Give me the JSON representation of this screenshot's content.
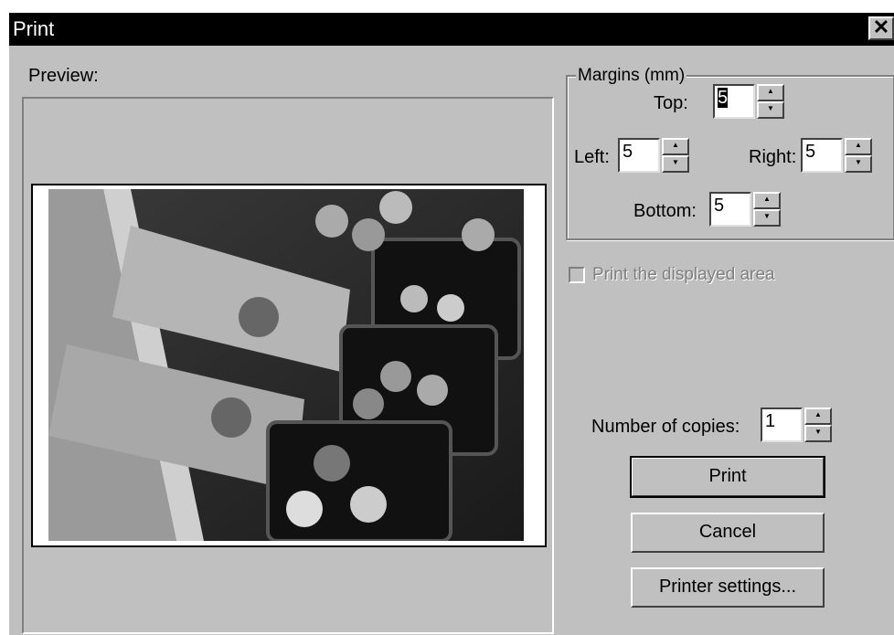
{
  "window": {
    "title": "Print",
    "close_label": "✕"
  },
  "preview": {
    "label": "Preview:"
  },
  "margins": {
    "group_label": "Margins (mm)",
    "top": {
      "label": "Top:",
      "value": "5"
    },
    "left": {
      "label": "Left:",
      "value": "5"
    },
    "right": {
      "label": "Right:",
      "value": "5"
    },
    "bottom": {
      "label": "Bottom:",
      "value": "5"
    }
  },
  "print_displayed_area": {
    "label": "Print the displayed area",
    "checked": false,
    "enabled": false
  },
  "copies": {
    "label": "Number of copies:",
    "value": "1"
  },
  "buttons": {
    "print": "Print",
    "cancel": "Cancel",
    "printer_settings": "Printer settings..."
  },
  "spin": {
    "up": "▲",
    "down": "▼"
  }
}
